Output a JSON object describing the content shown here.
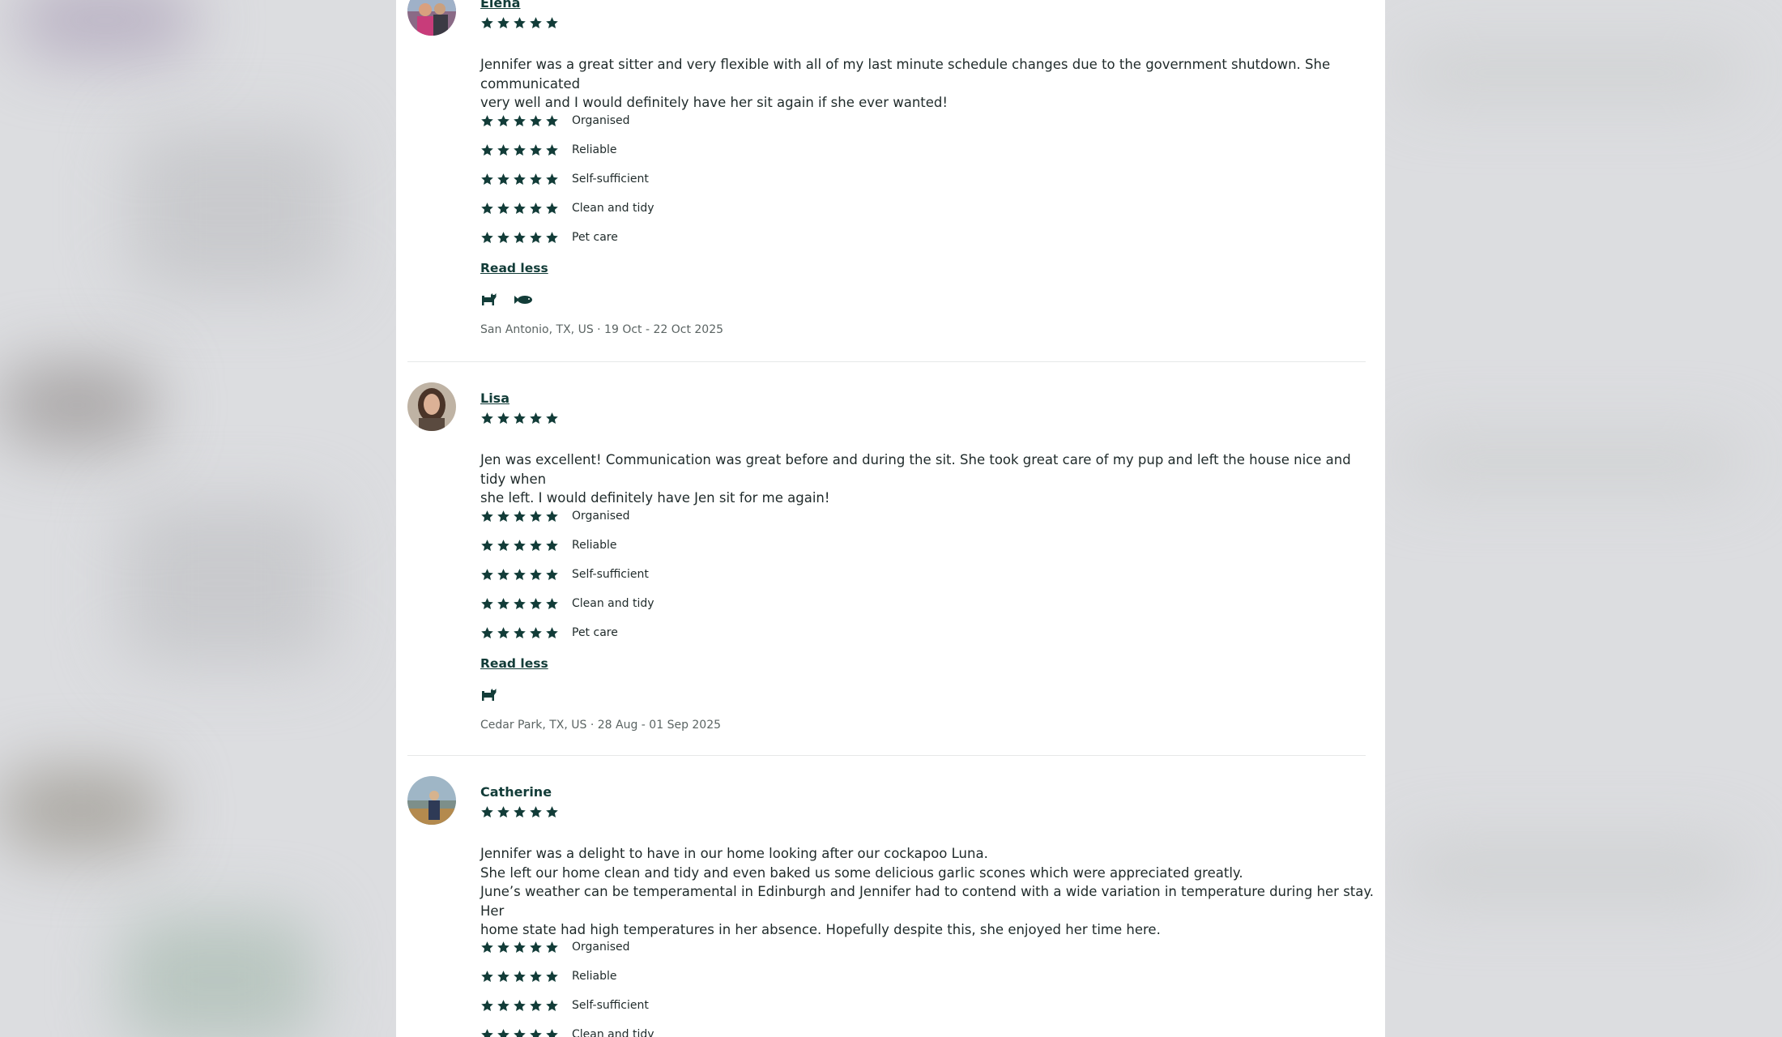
{
  "colors": {
    "accent": "#123c38",
    "text": "#1f2a2a",
    "muted": "#5b6463",
    "divider": "#e6e8e8"
  },
  "reviews": [
    {
      "name": "Elena",
      "name_linked": true,
      "overall_rating": 5,
      "text": "Jennifer was a great sitter and very flexible with all of my last minute schedule changes due to the government shutdown. She communicated\nvery well and I would definitely have her sit again if she ever wanted!",
      "categories": [
        {
          "label": "Organised",
          "rating": 5
        },
        {
          "label": "Reliable",
          "rating": 5
        },
        {
          "label": "Self-sufficient",
          "rating": 5
        },
        {
          "label": "Clean and tidy",
          "rating": 5
        },
        {
          "label": "Pet care",
          "rating": 5
        }
      ],
      "read_less": "Read less",
      "pets": [
        "dog-icon",
        "fish-icon"
      ],
      "meta": "San Antonio, TX, US · 19 Oct - 22 Oct 2025"
    },
    {
      "name": "Lisa",
      "name_linked": true,
      "overall_rating": 5,
      "text": "Jen was excellent! Communication was great before and during the sit. She took great care of my pup and left the house nice and tidy when\nshe left. I would definitely have Jen sit for me again!",
      "categories": [
        {
          "label": "Organised",
          "rating": 5
        },
        {
          "label": "Reliable",
          "rating": 5
        },
        {
          "label": "Self-sufficient",
          "rating": 5
        },
        {
          "label": "Clean and tidy",
          "rating": 5
        },
        {
          "label": "Pet care",
          "rating": 5
        }
      ],
      "read_less": "Read less",
      "pets": [
        "dog-icon"
      ],
      "meta": "Cedar Park, TX, US · 28 Aug - 01 Sep 2025"
    },
    {
      "name": "Catherine",
      "name_linked": false,
      "overall_rating": 5,
      "text": "Jennifer was a delight to have in our home looking after our cockapoo Luna.\nShe left our home clean and tidy and even baked us some delicious garlic scones which were appreciated greatly.\nJune’s weather can be temperamental in Edinburgh and Jennifer had to contend with a wide variation in temperature during her stay. Her\nhome state had high temperatures in her absence. Hopefully despite this, she enjoyed her time here.",
      "categories": [
        {
          "label": "Organised",
          "rating": 5
        },
        {
          "label": "Reliable",
          "rating": 5
        },
        {
          "label": "Self-sufficient",
          "rating": 5
        },
        {
          "label": "Clean and tidy",
          "rating": 5
        }
      ]
    }
  ]
}
